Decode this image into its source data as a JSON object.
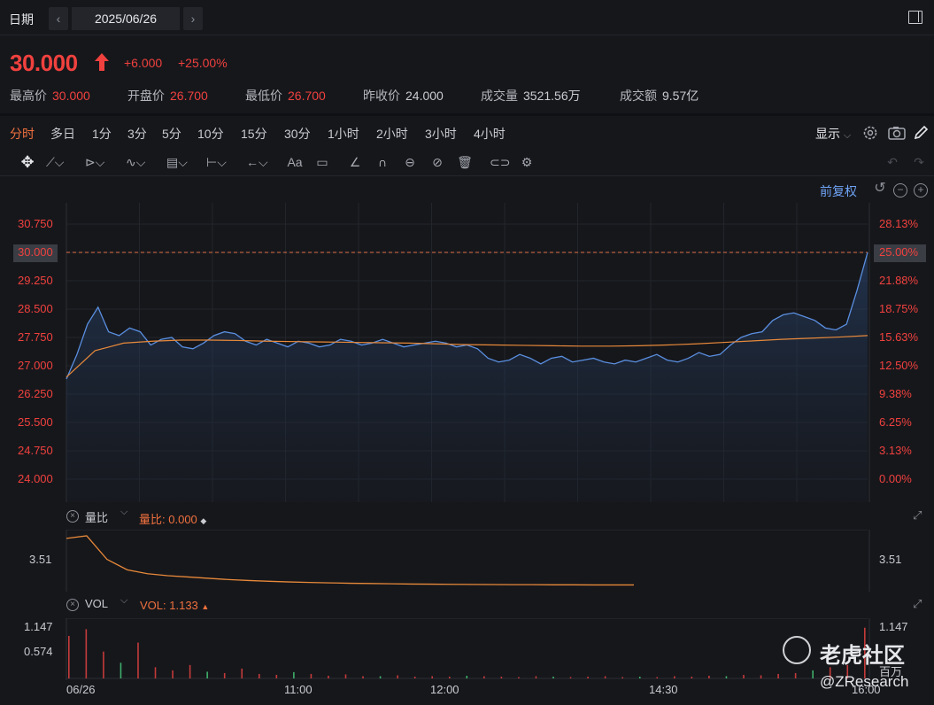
{
  "header": {
    "date_label": "日期",
    "date_value": "2025/06/26",
    "prev_icon": "chevron-left-icon",
    "next_icon": "chevron-right-icon",
    "panel_icon": "panel-toggle-icon"
  },
  "quote": {
    "price": "30.000",
    "change": "+6.000",
    "change_pct": "+25.00%",
    "stats": [
      {
        "label": "最高价",
        "value": "30.000"
      },
      {
        "label": "开盘价",
        "value": "26.700"
      },
      {
        "label": "最低价",
        "value": "26.700"
      },
      {
        "label": "昨收价",
        "value": "24.000"
      },
      {
        "label": "成交量",
        "value": "3521.56万"
      },
      {
        "label": "成交额",
        "value": "9.57亿"
      }
    ],
    "up_color": "#f0413e"
  },
  "timeframes": [
    "分时",
    "多日",
    "1分",
    "3分",
    "5分",
    "10分",
    "15分",
    "30分",
    "1小时",
    "2小时",
    "3小时",
    "4小时"
  ],
  "active_timeframe": "分时",
  "display_label": "显示",
  "toolbar_icons": [
    "move-icon",
    "line-tool-icon",
    "channel-tool-icon",
    "wave-tool-icon",
    "fib-tool-icon",
    "measure-tool-icon",
    "arrow-tool-icon",
    "text-tool-icon",
    "comment-tool-icon",
    "ruler-icon",
    "magnet-icon",
    "lock-icon",
    "hide-icon",
    "delete-icon",
    "link-icon",
    "settings-icon",
    "undo-icon",
    "redo-icon"
  ],
  "adjust_label": "前复权",
  "chart_data": [
    {
      "type": "line",
      "x_labels": [
        "06/26",
        "11:00",
        "12:00",
        "14:30",
        "16:00"
      ],
      "y_ticks": [
        "30.750",
        "30.000",
        "29.250",
        "28.500",
        "27.750",
        "27.000",
        "26.250",
        "25.500",
        "24.750",
        "24.000"
      ],
      "y_pct_ticks": [
        "28.13%",
        "25.00%",
        "21.88%",
        "18.75%",
        "15.63%",
        "12.50%",
        "9.38%",
        "6.25%",
        "3.13%",
        "0.00%"
      ],
      "ylim": [
        24.0,
        30.75
      ],
      "reference_line": 30.0,
      "series": [
        {
          "values": [
            26.65,
            27.3,
            28.1,
            28.55,
            27.9,
            27.8,
            28.0,
            27.9,
            27.55,
            27.7,
            27.75,
            27.5,
            27.45,
            27.6,
            27.8,
            27.9,
            27.85,
            27.65,
            27.55,
            27.7,
            27.6,
            27.5,
            27.65,
            27.6,
            27.5,
            27.55,
            27.7,
            27.65,
            27.55,
            27.6,
            27.7,
            27.6,
            27.5,
            27.55,
            27.6,
            27.65,
            27.6,
            27.5,
            27.55,
            27.45,
            27.2,
            27.1,
            27.15,
            27.3,
            27.2,
            27.05,
            27.2,
            27.25,
            27.1,
            27.15,
            27.2,
            27.1,
            27.05,
            27.15,
            27.1,
            27.2,
            27.3,
            27.15,
            27.1,
            27.2,
            27.35,
            27.25,
            27.3,
            27.55,
            27.75,
            27.85,
            27.9,
            28.2,
            28.35,
            28.4,
            28.3,
            28.2,
            28.0,
            27.95,
            28.1,
            29.0,
            30.0
          ]
        },
        {
          "values": [
            26.7,
            27.4,
            27.6,
            27.65,
            27.68,
            27.68,
            27.67,
            27.65,
            27.64,
            27.63,
            27.62,
            27.61,
            27.6,
            27.58,
            27.56,
            27.55,
            27.54,
            27.53,
            27.52,
            27.52,
            27.53,
            27.55,
            27.58,
            27.62,
            27.66,
            27.7,
            27.73,
            27.76,
            27.8
          ]
        }
      ]
    },
    {
      "type": "line",
      "label": "量比",
      "current_value": "0.000",
      "y_ticks": [
        "3.51"
      ],
      "series": [
        {
          "values": [
            3.8,
            4.0,
            2.2,
            1.4,
            1.1,
            0.95,
            0.85,
            0.75,
            0.65,
            0.58,
            0.52,
            0.47,
            0.43,
            0.4,
            0.37,
            0.35,
            0.33,
            0.31,
            0.3,
            0.29,
            0.28,
            0.27,
            0.26,
            0.26,
            0.25,
            0.25,
            0.24,
            0.24,
            0.24
          ]
        }
      ]
    },
    {
      "type": "bar",
      "label": "VOL",
      "current_value": "1.133",
      "y_ticks": [
        "1.147",
        "0.574"
      ],
      "unit": "百万",
      "series": [
        {
          "values": [
            0.95,
            1.1,
            0.6,
            0.35,
            0.8,
            0.25,
            0.18,
            0.3,
            0.15,
            0.12,
            0.22,
            0.1,
            0.08,
            0.14,
            0.1,
            0.06,
            0.09,
            0.05,
            0.05,
            0.07,
            0.04,
            0.05,
            0.04,
            0.06,
            0.05,
            0.04,
            0.03,
            0.05,
            0.04,
            0.03,
            0.04,
            0.05,
            0.03,
            0.04,
            0.03,
            0.05,
            0.04,
            0.06,
            0.05,
            0.08,
            0.07,
            0.1,
            0.12,
            0.18,
            0.25,
            0.3,
            1.133
          ]
        }
      ]
    }
  ],
  "indicator1": {
    "label": "量比",
    "value": "0.000"
  },
  "indicator2": {
    "label": "VOL",
    "value": "1.133"
  },
  "watermark": {
    "brand": "老虎社区",
    "handle": "@ZResearch",
    "unit": "百万",
    "right_top": "1.147"
  }
}
